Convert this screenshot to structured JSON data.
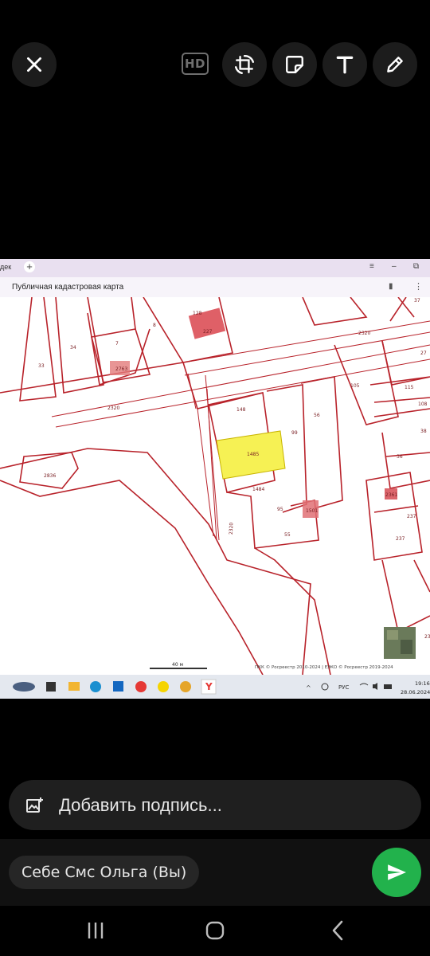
{
  "toolbar": {
    "close_icon": "close-icon",
    "hd_label": "HD",
    "crop_icon": "crop-rotate-icon",
    "sticker_icon": "sticker-icon",
    "text_icon": "text-icon",
    "pencil_icon": "pencil-icon"
  },
  "screenshot": {
    "tab_fragment": "дек",
    "page_title": "Публичная кадастровая карта",
    "map": {
      "highlight_color": "#f6f154",
      "boundary_color": "#b8222a",
      "parcel_labels": {
        "p37": "37",
        "p128": "128",
        "p8": "8",
        "p227": "227",
        "p2320a": "2320",
        "p7": "7",
        "p2763": "2763",
        "p34": "34",
        "p33": "33",
        "p27": "27",
        "p105": "105",
        "p115": "115",
        "p108": "108",
        "p2320b": "2320",
        "p148top": "148",
        "p99": "99",
        "p56": "56",
        "p38": "38",
        "p2836": "2836",
        "p1485": "1485",
        "p36": "36",
        "p1484": "1484",
        "p2361": "2361",
        "p95": "95",
        "p1501": "1501",
        "p237a": "237",
        "p237b": "237",
        "p2320c": "2320",
        "p55": "55",
        "p23": "23"
      },
      "scale_label": "40 м",
      "attribution": "ПКК © Росреестр 2010-2024 | ЕЭКО © Росреестр 2019-2024"
    },
    "taskbar": {
      "lang": "РУС",
      "time": "19:16",
      "date": "28.06.2024"
    }
  },
  "caption": {
    "placeholder": "Добавить подпись...",
    "icon": "add-image-icon"
  },
  "recipient": {
    "label": "Себе Смс Ольга (Вы)"
  },
  "send": {
    "icon": "send-icon",
    "color": "#22b24c"
  },
  "navbar": {
    "recents_icon": "recents-icon",
    "home_icon": "home-icon",
    "back_icon": "back-icon"
  }
}
